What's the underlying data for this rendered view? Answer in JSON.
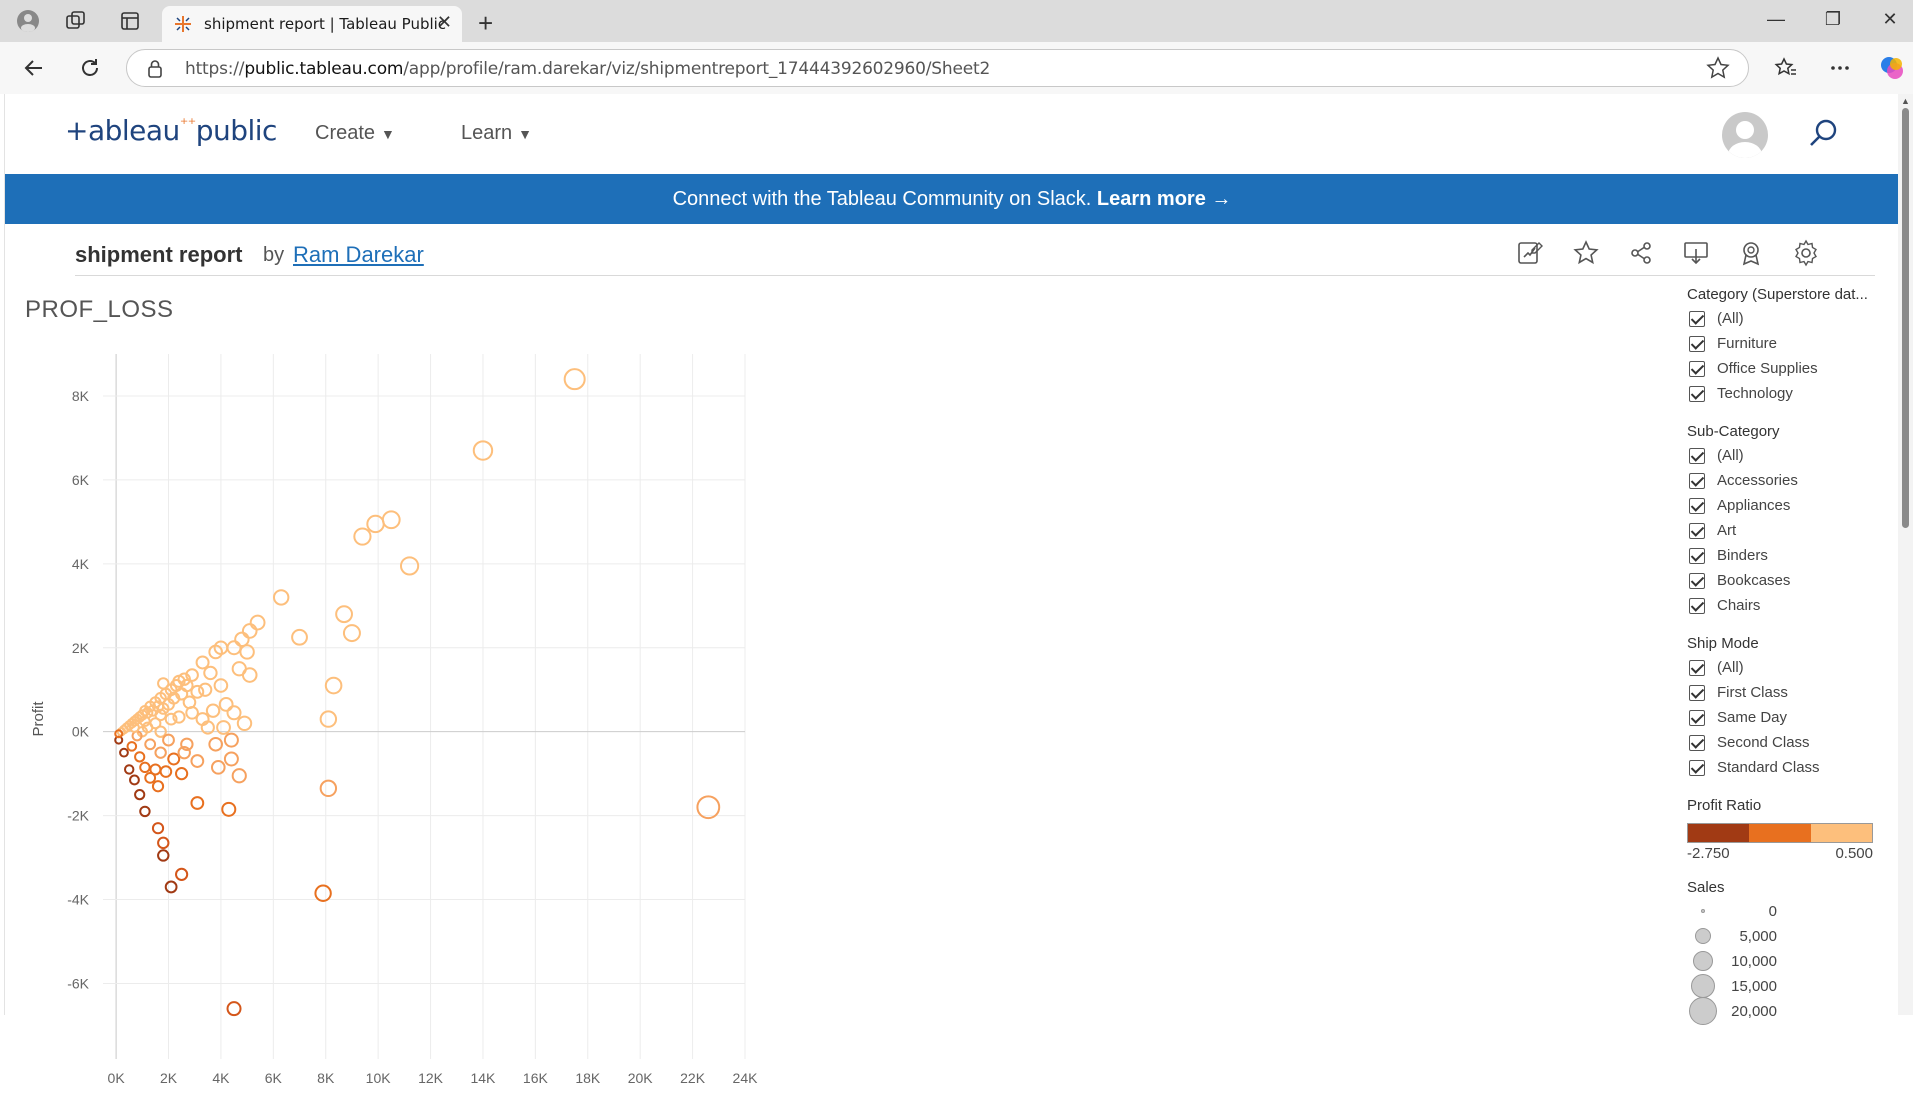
{
  "browser": {
    "tab_title": "shipment report | Tableau Public",
    "tab_close": "✕",
    "new_tab": "+",
    "url_prefix": "https://",
    "url_host": "public.tableau.com",
    "url_path": "/app/profile/ram.darekar/viz/shipmentreport_17444392602960/Sheet2",
    "window_controls": [
      "—",
      "❐",
      "✕"
    ]
  },
  "site": {
    "logo": "+ableau",
    "logo_suffix": "public",
    "nav": [
      {
        "label": "Create"
      },
      {
        "label": "Learn"
      }
    ],
    "banner_text": "Connect with the Tableau Community on Slack. ",
    "banner_link": "Learn more →"
  },
  "viz": {
    "title": "shipment report",
    "by": "by",
    "author": "Ram Darekar",
    "sheet_title": "PROF_LOSS"
  },
  "filters": {
    "category": {
      "title": "Category (Superstore dat...",
      "items": [
        "(All)",
        "Furniture",
        "Office Supplies",
        "Technology"
      ]
    },
    "subcategory": {
      "title": "Sub-Category",
      "items": [
        "(All)",
        "Accessories",
        "Appliances",
        "Art",
        "Binders",
        "Bookcases",
        "Chairs"
      ]
    },
    "ship_mode": {
      "title": "Ship Mode",
      "items": [
        "(All)",
        "First Class",
        "Same Day",
        "Second Class",
        "Standard Class"
      ]
    },
    "profit_ratio": {
      "title": "Profit Ratio",
      "min": "-2.750",
      "max": "0.500",
      "colors": [
        "#a13a14",
        "#e8701f",
        "#fdbf7c"
      ]
    },
    "sales": {
      "title": "Sales",
      "items": [
        "0",
        "5,000",
        "10,000",
        "15,000",
        "20,000"
      ]
    }
  },
  "chart_data": {
    "type": "scatter",
    "title": "PROF_LOSS",
    "xlabel": "",
    "ylabel": "Profit",
    "xlim": [
      -500,
      24000
    ],
    "ylim": [
      -7800,
      9000
    ],
    "x_ticks": [
      "0K",
      "2K",
      "4K",
      "6K",
      "8K",
      "10K",
      "12K",
      "14K",
      "16K",
      "18K",
      "20K",
      "22K",
      "24K"
    ],
    "y_ticks": [
      "8K",
      "6K",
      "4K",
      "2K",
      "0K",
      "-2K",
      "-4K",
      "-6K"
    ],
    "points": [
      {
        "x": 17500,
        "y": 8400,
        "sales": 17500,
        "ratio": 0.48
      },
      {
        "x": 14000,
        "y": 6700,
        "sales": 14000,
        "ratio": 0.48
      },
      {
        "x": 10500,
        "y": 5050,
        "sales": 10500,
        "ratio": 0.48
      },
      {
        "x": 9900,
        "y": 4950,
        "sales": 9900,
        "ratio": 0.48
      },
      {
        "x": 9400,
        "y": 4650,
        "sales": 9400,
        "ratio": 0.48
      },
      {
        "x": 11200,
        "y": 3950,
        "sales": 11200,
        "ratio": 0.35
      },
      {
        "x": 6300,
        "y": 3200,
        "sales": 6300,
        "ratio": 0.5
      },
      {
        "x": 8700,
        "y": 2800,
        "sales": 8700,
        "ratio": 0.32
      },
      {
        "x": 9000,
        "y": 2350,
        "sales": 9000,
        "ratio": 0.26
      },
      {
        "x": 7000,
        "y": 2250,
        "sales": 7000,
        "ratio": 0.32
      },
      {
        "x": 5400,
        "y": 2600,
        "sales": 5400,
        "ratio": 0.48
      },
      {
        "x": 5100,
        "y": 2400,
        "sales": 5100,
        "ratio": 0.47
      },
      {
        "x": 4800,
        "y": 2200,
        "sales": 4800,
        "ratio": 0.46
      },
      {
        "x": 4500,
        "y": 2000,
        "sales": 4500,
        "ratio": 0.44
      },
      {
        "x": 5000,
        "y": 1900,
        "sales": 5000,
        "ratio": 0.38
      },
      {
        "x": 3800,
        "y": 1900,
        "sales": 3800,
        "ratio": 0.5
      },
      {
        "x": 3300,
        "y": 1650,
        "sales": 3300,
        "ratio": 0.5
      },
      {
        "x": 5100,
        "y": 1350,
        "sales": 5100,
        "ratio": 0.26
      },
      {
        "x": 4700,
        "y": 1500,
        "sales": 4700,
        "ratio": 0.32
      },
      {
        "x": 8300,
        "y": 1100,
        "sales": 8300,
        "ratio": 0.13
      },
      {
        "x": 8100,
        "y": 300,
        "sales": 8100,
        "ratio": 0.04
      },
      {
        "x": 4000,
        "y": 1100,
        "sales": 4000,
        "ratio": 0.28
      },
      {
        "x": 3400,
        "y": 1000,
        "sales": 3400,
        "ratio": 0.3
      },
      {
        "x": 4200,
        "y": 650,
        "sales": 4200,
        "ratio": 0.15
      },
      {
        "x": 4500,
        "y": 450,
        "sales": 4500,
        "ratio": 0.1
      },
      {
        "x": 4900,
        "y": 200,
        "sales": 4900,
        "ratio": 0.04
      },
      {
        "x": 3700,
        "y": 500,
        "sales": 3700,
        "ratio": 0.13
      },
      {
        "x": 3500,
        "y": 100,
        "sales": 3500,
        "ratio": 0.03
      },
      {
        "x": 4100,
        "y": 100,
        "sales": 4100,
        "ratio": 0.02
      },
      {
        "x": 4400,
        "y": -200,
        "sales": 4400,
        "ratio": -0.05
      },
      {
        "x": 3800,
        "y": -300,
        "sales": 3800,
        "ratio": -0.08
      },
      {
        "x": 4400,
        "y": -650,
        "sales": 4400,
        "ratio": -0.15
      },
      {
        "x": 3900,
        "y": -850,
        "sales": 3900,
        "ratio": -0.22
      },
      {
        "x": 4700,
        "y": -1050,
        "sales": 4700,
        "ratio": -0.22
      },
      {
        "x": 8100,
        "y": -1350,
        "sales": 8100,
        "ratio": -0.17
      },
      {
        "x": 3100,
        "y": -700,
        "sales": 3100,
        "ratio": -0.22
      },
      {
        "x": 2500,
        "y": -1000,
        "sales": 2500,
        "ratio": -0.4
      },
      {
        "x": 3100,
        "y": -1700,
        "sales": 3100,
        "ratio": -0.55
      },
      {
        "x": 4300,
        "y": -1850,
        "sales": 4300,
        "ratio": -0.43
      },
      {
        "x": 22600,
        "y": -1800,
        "sales": 22600,
        "ratio": -0.08
      },
      {
        "x": 7900,
        "y": -3850,
        "sales": 7900,
        "ratio": -0.49
      },
      {
        "x": 4500,
        "y": -6600,
        "sales": 4500,
        "ratio": -1.47
      },
      {
        "x": 2500,
        "y": -3400,
        "sales": 2500,
        "ratio": -1.36
      },
      {
        "x": 2100,
        "y": -3700,
        "sales": 2100,
        "ratio": -1.76
      },
      {
        "x": 1800,
        "y": -2950,
        "sales": 1800,
        "ratio": -1.64
      },
      {
        "x": 1800,
        "y": -2650,
        "sales": 1800,
        "ratio": -1.47
      },
      {
        "x": 1600,
        "y": -2300,
        "sales": 1600,
        "ratio": -1.44
      },
      {
        "x": 1100,
        "y": -1900,
        "sales": 1100,
        "ratio": -1.73
      },
      {
        "x": 900,
        "y": -1500,
        "sales": 900,
        "ratio": -1.67
      },
      {
        "x": 1600,
        "y": -1300,
        "sales": 1600,
        "ratio": -0.81
      },
      {
        "x": 1300,
        "y": -1100,
        "sales": 1300,
        "ratio": -0.85
      },
      {
        "x": 700,
        "y": -1150,
        "sales": 700,
        "ratio": -1.64
      },
      {
        "x": 500,
        "y": -900,
        "sales": 500,
        "ratio": -1.8
      },
      {
        "x": 300,
        "y": -500,
        "sales": 300,
        "ratio": -1.67
      },
      {
        "x": 100,
        "y": -200,
        "sales": 100,
        "ratio": -2.0
      },
      {
        "x": 1100,
        "y": -850,
        "sales": 1100,
        "ratio": -0.77
      },
      {
        "x": 1500,
        "y": -900,
        "sales": 1500,
        "ratio": -0.6
      },
      {
        "x": 1900,
        "y": -950,
        "sales": 1900,
        "ratio": -0.5
      },
      {
        "x": 2200,
        "y": -650,
        "sales": 2200,
        "ratio": -0.3
      },
      {
        "x": 2600,
        "y": -500,
        "sales": 2600,
        "ratio": -0.19
      },
      {
        "x": 1700,
        "y": -500,
        "sales": 1700,
        "ratio": -0.29
      },
      {
        "x": 2700,
        "y": -300,
        "sales": 2700,
        "ratio": -0.11
      },
      {
        "x": 3300,
        "y": 300,
        "sales": 3300,
        "ratio": 0.09
      },
      {
        "x": 2900,
        "y": 450,
        "sales": 2900,
        "ratio": 0.16
      },
      {
        "x": 2700,
        "y": 1100,
        "sales": 2700,
        "ratio": 0.41
      },
      {
        "x": 2900,
        "y": 1350,
        "sales": 2900,
        "ratio": 0.47
      },
      {
        "x": 2600,
        "y": 1250,
        "sales": 2600,
        "ratio": 0.48
      },
      {
        "x": 2300,
        "y": 1100,
        "sales": 2300,
        "ratio": 0.48
      },
      {
        "x": 2100,
        "y": 1000,
        "sales": 2100,
        "ratio": 0.48
      },
      {
        "x": 2500,
        "y": 900,
        "sales": 2500,
        "ratio": 0.36
      },
      {
        "x": 2200,
        "y": 800,
        "sales": 2200,
        "ratio": 0.36
      },
      {
        "x": 1900,
        "y": 900,
        "sales": 1900,
        "ratio": 0.47
      },
      {
        "x": 1700,
        "y": 800,
        "sales": 1700,
        "ratio": 0.47
      },
      {
        "x": 1500,
        "y": 700,
        "sales": 1500,
        "ratio": 0.47
      },
      {
        "x": 2000,
        "y": 650,
        "sales": 2000,
        "ratio": 0.32
      },
      {
        "x": 1800,
        "y": 550,
        "sales": 1800,
        "ratio": 0.31
      },
      {
        "x": 1600,
        "y": 600,
        "sales": 1600,
        "ratio": 0.38
      },
      {
        "x": 1400,
        "y": 500,
        "sales": 1400,
        "ratio": 0.36
      },
      {
        "x": 1300,
        "y": 600,
        "sales": 1300,
        "ratio": 0.46
      },
      {
        "x": 1200,
        "y": 450,
        "sales": 1200,
        "ratio": 0.38
      },
      {
        "x": 1100,
        "y": 500,
        "sales": 1100,
        "ratio": 0.45
      },
      {
        "x": 1000,
        "y": 400,
        "sales": 1000,
        "ratio": 0.4
      },
      {
        "x": 900,
        "y": 350,
        "sales": 900,
        "ratio": 0.39
      },
      {
        "x": 800,
        "y": 300,
        "sales": 800,
        "ratio": 0.38
      },
      {
        "x": 700,
        "y": 250,
        "sales": 700,
        "ratio": 0.36
      },
      {
        "x": 600,
        "y": 200,
        "sales": 600,
        "ratio": 0.33
      },
      {
        "x": 500,
        "y": 150,
        "sales": 500,
        "ratio": 0.3
      },
      {
        "x": 400,
        "y": 100,
        "sales": 400,
        "ratio": 0.25
      },
      {
        "x": 300,
        "y": 50,
        "sales": 300,
        "ratio": 0.17
      },
      {
        "x": 200,
        "y": 0,
        "sales": 200,
        "ratio": 0.0
      },
      {
        "x": 100,
        "y": -50,
        "sales": 100,
        "ratio": -0.3
      },
      {
        "x": 1500,
        "y": 200,
        "sales": 1500,
        "ratio": 0.13
      },
      {
        "x": 1200,
        "y": 100,
        "sales": 1200,
        "ratio": 0.08
      },
      {
        "x": 1000,
        "y": 0,
        "sales": 1000,
        "ratio": 0.0
      },
      {
        "x": 800,
        "y": -100,
        "sales": 800,
        "ratio": -0.13
      },
      {
        "x": 1700,
        "y": 0,
        "sales": 1700,
        "ratio": 0.0
      },
      {
        "x": 2100,
        "y": 300,
        "sales": 2100,
        "ratio": 0.14
      },
      {
        "x": 2400,
        "y": 350,
        "sales": 2400,
        "ratio": 0.15
      },
      {
        "x": 2000,
        "y": -200,
        "sales": 2000,
        "ratio": -0.1
      },
      {
        "x": 1300,
        "y": -300,
        "sales": 1300,
        "ratio": -0.23
      },
      {
        "x": 600,
        "y": -350,
        "sales": 600,
        "ratio": -0.58
      },
      {
        "x": 900,
        "y": -600,
        "sales": 900,
        "ratio": -0.67
      },
      {
        "x": 1700,
        "y": 400,
        "sales": 1700,
        "ratio": 0.24
      },
      {
        "x": 1100,
        "y": 250,
        "sales": 1100,
        "ratio": 0.23
      },
      {
        "x": 700,
        "y": 100,
        "sales": 700,
        "ratio": 0.14
      },
      {
        "x": 2800,
        "y": 700,
        "sales": 2800,
        "ratio": 0.25
      },
      {
        "x": 3100,
        "y": 950,
        "sales": 3100,
        "ratio": 0.31
      },
      {
        "x": 3600,
        "y": 1400,
        "sales": 3600,
        "ratio": 0.39
      },
      {
        "x": 2400,
        "y": 1200,
        "sales": 2400,
        "ratio": 0.5
      },
      {
        "x": 1800,
        "y": 1150,
        "sales": 1800,
        "ratio": 0.64
      },
      {
        "x": 4000,
        "y": 2000,
        "sales": 4000,
        "ratio": 0.5
      }
    ]
  }
}
